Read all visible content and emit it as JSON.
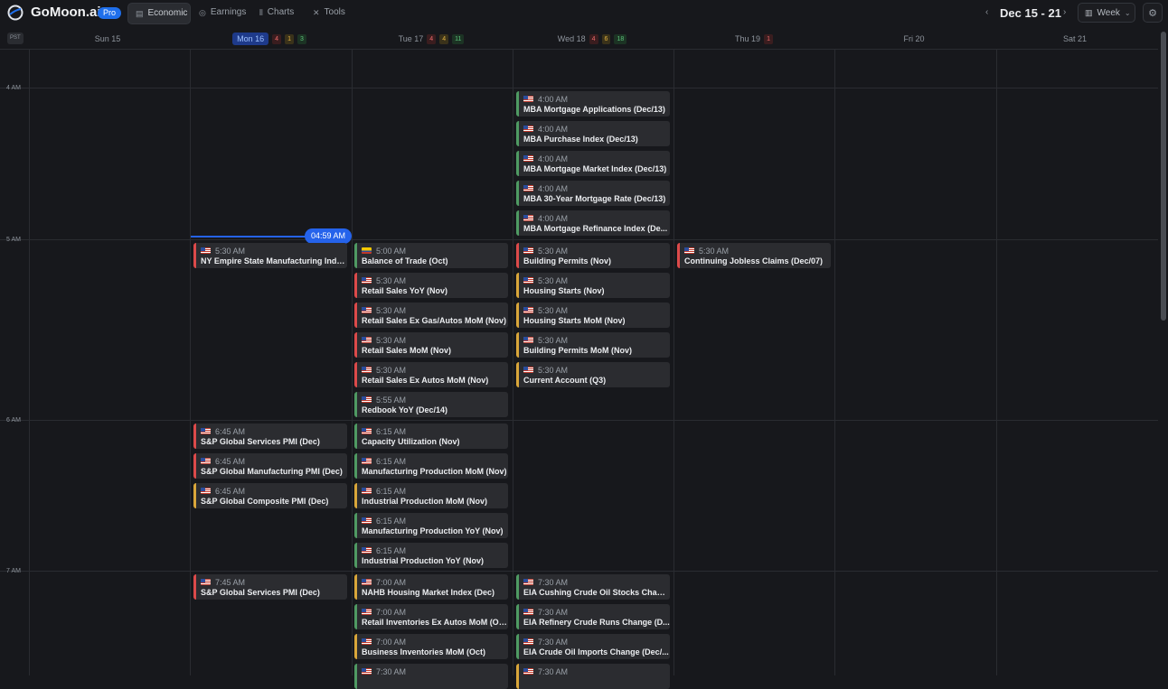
{
  "header": {
    "brand": "GoMoon.ai",
    "badge": "Pro",
    "tabs": [
      {
        "label": "Economic",
        "icon": "calendar-icon",
        "active": true
      },
      {
        "label": "Earnings",
        "icon": "coins-icon",
        "active": false
      },
      {
        "label": "Charts",
        "icon": "candles-icon",
        "active": false
      },
      {
        "label": "Tools",
        "icon": "tools-icon",
        "active": false
      }
    ],
    "date_range": "Dec 15 - 21",
    "view": "Week"
  },
  "timezone": "PST",
  "days": [
    {
      "label": "Sun 15",
      "today": false,
      "counts": []
    },
    {
      "label": "Mon 16",
      "today": true,
      "counts": [
        {
          "n": "4",
          "level": "high"
        },
        {
          "n": "1",
          "level": "med"
        },
        {
          "n": "3",
          "level": "low"
        }
      ]
    },
    {
      "label": "Tue 17",
      "today": false,
      "counts": [
        {
          "n": "4",
          "level": "high"
        },
        {
          "n": "4",
          "level": "med"
        },
        {
          "n": "11",
          "level": "low"
        }
      ]
    },
    {
      "label": "Wed 18",
      "today": false,
      "counts": [
        {
          "n": "4",
          "level": "high"
        },
        {
          "n": "6",
          "level": "med"
        },
        {
          "n": "18",
          "level": "low"
        }
      ]
    },
    {
      "label": "Thu 19",
      "today": false,
      "counts": [
        {
          "n": "1",
          "level": "high"
        }
      ]
    },
    {
      "label": "Fri 20",
      "today": false,
      "counts": []
    },
    {
      "label": "Sat 21",
      "today": false,
      "counts": []
    }
  ],
  "hours": [
    "4 AM",
    "5 AM",
    "6 AM",
    "7 AM"
  ],
  "now_label": "04:59 AM",
  "events": {
    "mon": [
      {
        "time": "5:30 AM",
        "title": "NY Empire State Manufacturing Inde...",
        "level": "high",
        "flag": "us"
      },
      {
        "time": "6:45 AM",
        "title": "S&P Global Services PMI (Dec)",
        "level": "high",
        "flag": "us"
      },
      {
        "time": "6:45 AM",
        "title": "S&P Global Manufacturing PMI (Dec)",
        "level": "high",
        "flag": "us"
      },
      {
        "time": "6:45 AM",
        "title": "S&P Global Composite PMI (Dec)",
        "level": "med",
        "flag": "us"
      },
      {
        "time": "7:45 AM",
        "title": "S&P Global Services PMI (Dec)",
        "level": "high",
        "flag": "us"
      }
    ],
    "tue": [
      {
        "time": "5:00 AM",
        "title": "Balance of Trade (Oct)",
        "level": "low",
        "flag": "co"
      },
      {
        "time": "5:30 AM",
        "title": "Retail Sales YoY (Nov)",
        "level": "high",
        "flag": "us"
      },
      {
        "time": "5:30 AM",
        "title": "Retail Sales Ex Gas/Autos MoM (Nov)",
        "level": "high",
        "flag": "us"
      },
      {
        "time": "5:30 AM",
        "title": "Retail Sales MoM (Nov)",
        "level": "high",
        "flag": "us"
      },
      {
        "time": "5:30 AM",
        "title": "Retail Sales Ex Autos MoM (Nov)",
        "level": "high",
        "flag": "us"
      },
      {
        "time": "5:55 AM",
        "title": "Redbook YoY (Dec/14)",
        "level": "low",
        "flag": "us"
      },
      {
        "time": "6:15 AM",
        "title": "Capacity Utilization (Nov)",
        "level": "low",
        "flag": "us"
      },
      {
        "time": "6:15 AM",
        "title": "Manufacturing Production MoM (Nov)",
        "level": "low",
        "flag": "us"
      },
      {
        "time": "6:15 AM",
        "title": "Industrial Production MoM (Nov)",
        "level": "med",
        "flag": "us"
      },
      {
        "time": "6:15 AM",
        "title": "Manufacturing Production YoY (Nov)",
        "level": "low",
        "flag": "us"
      },
      {
        "time": "6:15 AM",
        "title": "Industrial Production YoY (Nov)",
        "level": "low",
        "flag": "us"
      },
      {
        "time": "7:00 AM",
        "title": "NAHB Housing Market Index (Dec)",
        "level": "med",
        "flag": "us"
      },
      {
        "time": "7:00 AM",
        "title": "Retail Inventories Ex Autos MoM (Oct)",
        "level": "low",
        "flag": "us"
      },
      {
        "time": "7:00 AM",
        "title": "Business Inventories MoM (Oct)",
        "level": "med",
        "flag": "us"
      },
      {
        "time": "7:30 AM",
        "title": "",
        "level": "low",
        "flag": "us"
      }
    ],
    "wed": [
      {
        "time": "4:00 AM",
        "title": "MBA Mortgage Applications (Dec/13)",
        "level": "low",
        "flag": "us"
      },
      {
        "time": "4:00 AM",
        "title": "MBA Purchase Index (Dec/13)",
        "level": "low",
        "flag": "us"
      },
      {
        "time": "4:00 AM",
        "title": "MBA Mortgage Market Index (Dec/13)",
        "level": "low",
        "flag": "us"
      },
      {
        "time": "4:00 AM",
        "title": "MBA 30-Year Mortgage Rate (Dec/13)",
        "level": "low",
        "flag": "us"
      },
      {
        "time": "4:00 AM",
        "title": "MBA Mortgage Refinance Index (De...",
        "level": "low",
        "flag": "us"
      },
      {
        "time": "5:30 AM",
        "title": "Building Permits (Nov)",
        "level": "high",
        "flag": "us"
      },
      {
        "time": "5:30 AM",
        "title": "Housing Starts (Nov)",
        "level": "med",
        "flag": "us"
      },
      {
        "time": "5:30 AM",
        "title": "Housing Starts MoM (Nov)",
        "level": "med",
        "flag": "us"
      },
      {
        "time": "5:30 AM",
        "title": "Building Permits MoM (Nov)",
        "level": "med",
        "flag": "us"
      },
      {
        "time": "5:30 AM",
        "title": "Current Account (Q3)",
        "level": "med",
        "flag": "us"
      },
      {
        "time": "7:30 AM",
        "title": "EIA Cushing Crude Oil Stocks Chang...",
        "level": "low",
        "flag": "us"
      },
      {
        "time": "7:30 AM",
        "title": "EIA Refinery Crude Runs Change (D...",
        "level": "low",
        "flag": "us"
      },
      {
        "time": "7:30 AM",
        "title": "EIA Crude Oil Imports Change (Dec/...",
        "level": "low",
        "flag": "us"
      },
      {
        "time": "7:30 AM",
        "title": "",
        "level": "med",
        "flag": "us"
      }
    ],
    "thu": [
      {
        "time": "5:30 AM",
        "title": "Continuing Jobless Claims (Dec/07)",
        "level": "high",
        "flag": "us"
      }
    ]
  }
}
